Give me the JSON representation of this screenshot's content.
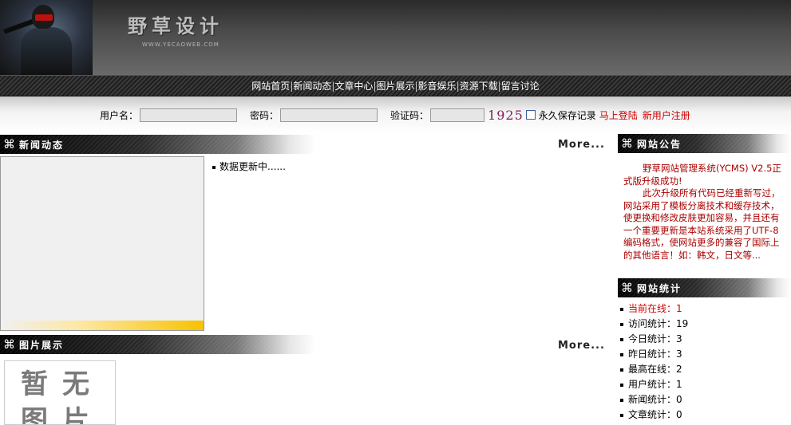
{
  "header": {
    "logo_title": "野草设计",
    "logo_url": "WWW.YECAOWEB.COM"
  },
  "nav": {
    "items": [
      "网站首页",
      "新闻动态",
      "文章中心",
      "图片展示",
      "影音娱乐",
      "资源下载",
      "留言讨论"
    ],
    "separator": "|"
  },
  "login": {
    "username_label": "用户名：",
    "username_value": "",
    "password_label": "密码：",
    "password_value": "",
    "captcha_label": "验证码：",
    "captcha_value": "",
    "captcha_code": "1925",
    "remember_label": "永久保存记录",
    "remember_checked": false,
    "login_link": "马上登陆",
    "register_link": "新用户注册"
  },
  "news": {
    "heading": "新闻动态",
    "more": "More...",
    "items": [
      "数据更新中......"
    ]
  },
  "pictures": {
    "heading": "图片展示",
    "more": "More...",
    "placeholder": "暂无图片"
  },
  "notice": {
    "heading": "网站公告",
    "paragraphs": [
      "野草网站管理系统(YCMS) V2.5正式版升级成功!",
      "此次升级所有代码已经重新写过，网站采用了模板分离技术和缓存技术，使更换和修改皮肤更加容易，并且还有一个重要更新是本站系统采用了UTF-8编码格式，使网站更多的兼容了国际上的其他语言！如：韩文，日文等..."
    ]
  },
  "stats": {
    "heading": "网站统计",
    "rows": [
      {
        "label": "当前在线：1",
        "highlight": true
      },
      {
        "label": "访问统计：19",
        "highlight": false
      },
      {
        "label": "今日统计：3",
        "highlight": false
      },
      {
        "label": "昨日统计：3",
        "highlight": false
      },
      {
        "label": "最高在线：2",
        "highlight": false
      },
      {
        "label": "用户统计：1",
        "highlight": false
      },
      {
        "label": "新闻统计：0",
        "highlight": false
      },
      {
        "label": "文章统计：0",
        "highlight": false
      }
    ]
  },
  "icons": {
    "section_icon": "command-key-icon",
    "section_glyph": "⌘"
  },
  "colors": {
    "accent_red": "#cc0000",
    "notice_text": "#aa0000",
    "captcha": "#7b1d5b"
  }
}
